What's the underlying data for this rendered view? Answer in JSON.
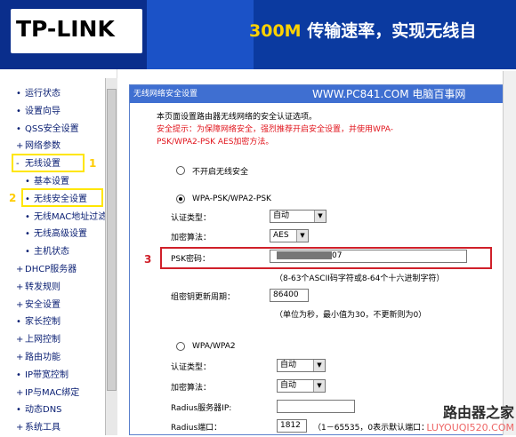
{
  "header": {
    "logo": "TP-LINK",
    "slogan_speed": "300M",
    "slogan_text": "传输速率，实现无线自"
  },
  "sidebar": {
    "items": [
      {
        "label": "运行状态",
        "bullet": "•"
      },
      {
        "label": "设置向导",
        "bullet": "•"
      },
      {
        "label": "QSS安全设置",
        "bullet": "•"
      },
      {
        "label": "网络参数",
        "bullet": "+"
      },
      {
        "label": "无线设置",
        "bullet": "-"
      },
      {
        "label": "基本设置",
        "bullet": "•"
      },
      {
        "label": "无线安全设置",
        "bullet": "•"
      },
      {
        "label": "无线MAC地址过滤",
        "bullet": "•"
      },
      {
        "label": "无线高级设置",
        "bullet": "•"
      },
      {
        "label": "主机状态",
        "bullet": "•"
      },
      {
        "label": "DHCP服务器",
        "bullet": "+"
      },
      {
        "label": "转发规则",
        "bullet": "+"
      },
      {
        "label": "安全设置",
        "bullet": "+"
      },
      {
        "label": "家长控制",
        "bullet": "•"
      },
      {
        "label": "上网控制",
        "bullet": "+"
      },
      {
        "label": "路由功能",
        "bullet": "+"
      },
      {
        "label": "IP带宽控制",
        "bullet": "•"
      },
      {
        "label": "IP与MAC绑定",
        "bullet": "+"
      },
      {
        "label": "动态DNS",
        "bullet": "•"
      },
      {
        "label": "系统工具",
        "bullet": "+"
      }
    ],
    "annotations": {
      "n1": "1",
      "n2": "2"
    }
  },
  "panel": {
    "title": "无线网络安全设置",
    "watermark": "WWW.PC841.COM 电脑百事网",
    "intro": "本页面设置路由器无线网络的安全认证选项。",
    "tip_line1": "安全提示：为保障网络安全，强烈推荐开启安全设置，并使用WPA-",
    "tip_line2": "PSK/WPA2-PSK AES加密方法。",
    "opt_none": "不开启无线安全",
    "opt_wpa_psk": "WPA-PSK/WPA2-PSK",
    "auth_label": "认证类型：",
    "auth_value": "自动",
    "enc_label": "加密算法：",
    "enc_value": "AES",
    "psk_label": "PSK密码：",
    "psk_value": "07",
    "psk_hint": "（8-63个ASCII码字符或8-64个十六进制字符）",
    "renew_label": "组密钥更新周期：",
    "renew_value": "86400",
    "renew_hint": "（单位为秒，最小值为30，不更新则为0）",
    "opt_wpa": "WPA/WPA2",
    "auth2_label": "认证类型：",
    "auth2_value": "自动",
    "enc2_label": "加密算法：",
    "enc2_value": "自动",
    "radius_ip_label": "Radius服务器IP:",
    "radius_port_label": "Radius端口：",
    "radius_port_value": "1812",
    "radius_port_hint": "（1－65535，0表示默认端口：",
    "annotation3": "3"
  },
  "watermark": {
    "main": "路由器之家",
    "sub": "LUYOUQI520.COM"
  }
}
